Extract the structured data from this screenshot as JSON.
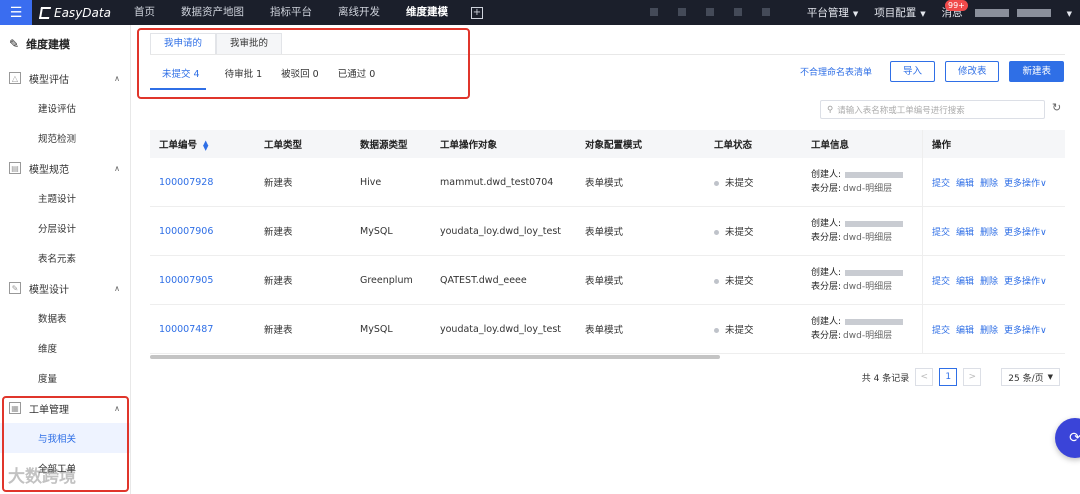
{
  "app": {
    "logo_text": "EasyData"
  },
  "topnav": {
    "items": [
      {
        "label": "首页",
        "active": false
      },
      {
        "label": "数据资产地图",
        "active": false
      },
      {
        "label": "指标平台",
        "active": false
      },
      {
        "label": "离线开发",
        "active": false
      },
      {
        "label": "维度建模",
        "active": true
      }
    ],
    "right": {
      "platform": "平台管理",
      "project": "项目配置",
      "messages": "消息",
      "badge": "99+"
    }
  },
  "sidebar": {
    "title": "维度建模",
    "groups": [
      {
        "label": "模型评估",
        "items": [
          "建设评估",
          "规范检测"
        ]
      },
      {
        "label": "模型规范",
        "items": [
          "主题设计",
          "分层设计",
          "表名元素"
        ]
      },
      {
        "label": "模型设计",
        "items": [
          "数据表",
          "维度",
          "度量"
        ]
      },
      {
        "label": "工单管理",
        "items": [
          "与我相关",
          "全部工单"
        ]
      }
    ],
    "active_item": "与我相关"
  },
  "tabs": [
    "我申请的",
    "我审批的"
  ],
  "subtabs": [
    "未提交 4",
    "待审批 1",
    "被驳回 0",
    "已通过 0"
  ],
  "actions": {
    "link": "不合理命名表清单",
    "import": "导入",
    "modify": "修改表",
    "create": "新建表"
  },
  "search": {
    "placeholder": "请输入表名称或工单编号进行搜索"
  },
  "table": {
    "columns": [
      "工单编号",
      "工单类型",
      "数据源类型",
      "工单操作对象",
      "对象配置模式",
      "工单状态",
      "工单信息",
      "操作"
    ],
    "rows": [
      {
        "id": "100007928",
        "type": "新建表",
        "source": "Hive",
        "object": "mammut.dwd_test0704",
        "mode": "表单模式",
        "status": "未提交",
        "creator_label": "创建人:",
        "layer_label": "表分层:",
        "layer": "dwd-明细层"
      },
      {
        "id": "100007906",
        "type": "新建表",
        "source": "MySQL",
        "object": "youdata_loy.dwd_loy_test",
        "mode": "表单模式",
        "status": "未提交",
        "creator_label": "创建人:",
        "layer_label": "表分层:",
        "layer": "dwd-明细层"
      },
      {
        "id": "100007905",
        "type": "新建表",
        "source": "Greenplum",
        "object": "QATEST.dwd_eeee",
        "mode": "表单模式",
        "status": "未提交",
        "creator_label": "创建人:",
        "layer_label": "表分层:",
        "layer": "dwd-明细层"
      },
      {
        "id": "100007487",
        "type": "新建表",
        "source": "MySQL",
        "object": "youdata_loy.dwd_loy_test",
        "mode": "表单模式",
        "status": "未提交",
        "creator_label": "创建人:",
        "layer_label": "表分层:",
        "layer": "dwd-明细层"
      }
    ],
    "row_ops": [
      "提交",
      "编辑",
      "删除",
      "更多操作"
    ]
  },
  "pager": {
    "total": "共 4 条记录",
    "page": "1",
    "size": "25 条/页"
  },
  "watermark_logo": "大数跨境"
}
